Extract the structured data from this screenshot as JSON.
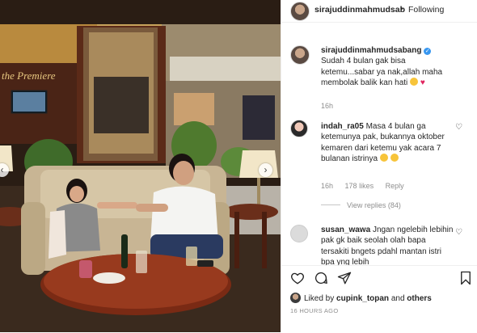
{
  "post": {
    "username": "sirajuddinmahmudsab",
    "follow_label": "Following",
    "separator": "•",
    "photo_sign": "the Premiere"
  },
  "caption": {
    "username": "sirajuddinmahmudsabang",
    "verified_mark": "✓",
    "text": "Sudah 4 bulan gak bisa ketemu...sabar ya nak,allah maha membolak balik kan hati",
    "time": "16h"
  },
  "comments": [
    {
      "username": "indah_ra05",
      "text": "Masa 4 bulan ga ketemunya pak, bukannya oktober kemaren dari ketemu yak acara 7 bulanan istrinya",
      "time": "16h",
      "likes": "178 likes",
      "reply_label": "Reply",
      "view_replies": "View replies (84)"
    },
    {
      "username": "susan_wawa",
      "text": "Jngan ngelebih lebihin pak gk baik seolah olah bapa tersakiti bngets pdahl mantan istri bpa yng lebih"
    }
  ],
  "footer": {
    "liked_prefix": "Liked by",
    "liked_user": "cupink_topan",
    "liked_and": "and",
    "liked_others": "others",
    "time_ago": "16 HOURS AGO"
  },
  "icons": {
    "like": "heart-outline-icon",
    "comment": "comment-icon",
    "share": "paper-plane-icon",
    "save": "bookmark-icon"
  }
}
